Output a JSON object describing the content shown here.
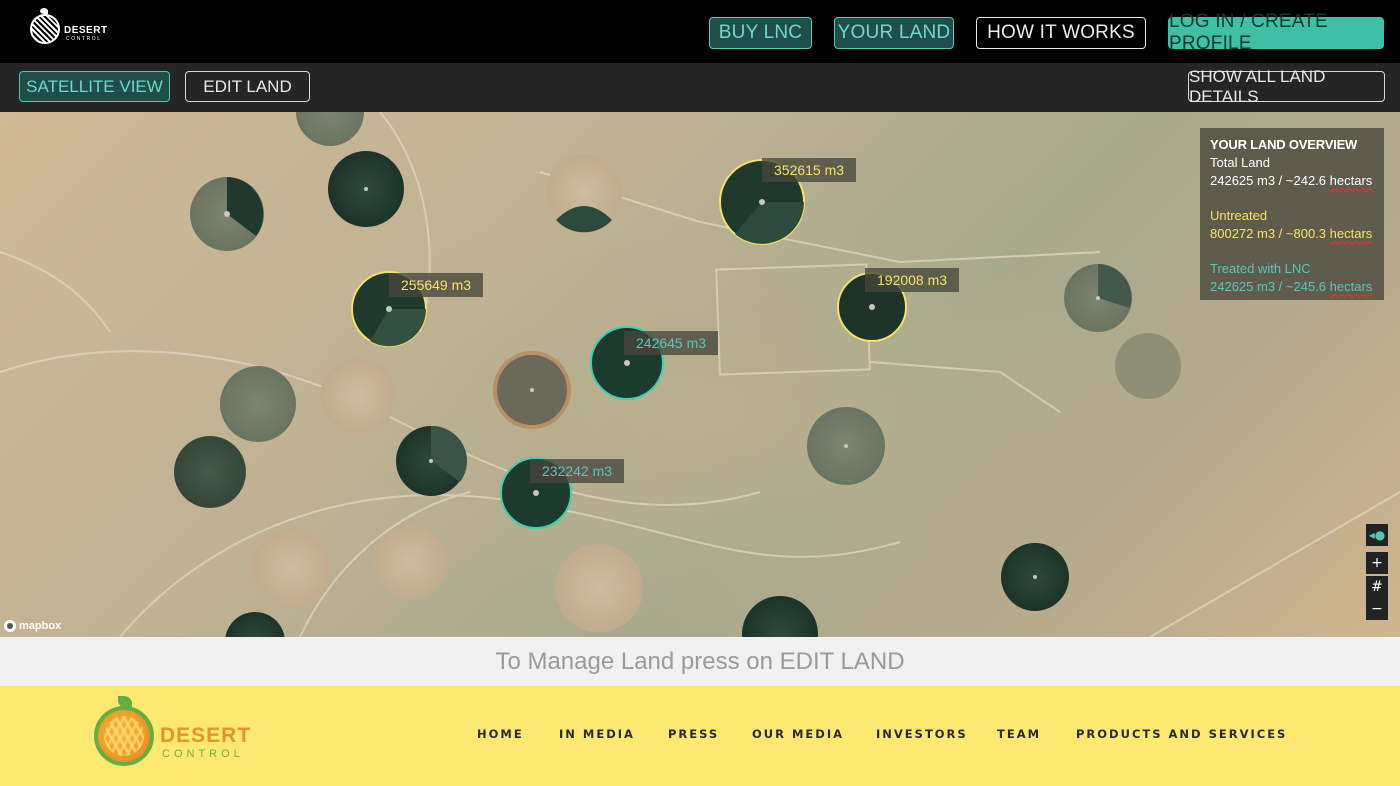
{
  "header": {
    "logo_brand": "DESERT",
    "logo_sub": "CONTROL",
    "buttons": {
      "buy": "BUY LNC",
      "your_land": "YOUR LAND",
      "how": "HOW IT WORKS",
      "login": "LOG IN / CREATE PROFILE"
    }
  },
  "toolbar": {
    "satellite": "SATELLITE VIEW",
    "edit": "EDIT LAND",
    "show_all": "SHOW ALL LAND DETAILS"
  },
  "map": {
    "labels": [
      {
        "text": "352615 m3",
        "status": "untreated"
      },
      {
        "text": "255649 m3",
        "status": "untreated"
      },
      {
        "text": "192008 m3",
        "status": "untreated"
      },
      {
        "text": "242645 m3",
        "status": "treated"
      },
      {
        "text": "232242 m3",
        "status": "treated"
      }
    ],
    "attribution": "mapbox",
    "controls": {
      "zoom_in": "+",
      "grid": "#",
      "zoom_out": "−"
    }
  },
  "overview": {
    "title": "YOUR LAND OVERVIEW",
    "total_label": "Total Land",
    "total_value": "242625 m3 / ~242.6",
    "untreated_label": "Untreated",
    "untreated_value": "800272 m3 / ~800.3",
    "treated_label": "Treated with LNC",
    "treated_value": "242625 m3 / ~245.6",
    "unit": "hectars"
  },
  "instruction": "To Manage Land press on EDIT LAND",
  "footer": {
    "logo_brand": "DESERT",
    "logo_sub": "CONTROL",
    "links": [
      "HOME",
      "IN MEDIA",
      "PRESS",
      "OUR MEDIA",
      "INVESTORS",
      "TEAM",
      "PRODUCTS AND SERVICES"
    ]
  },
  "colors": {
    "accent_teal": "#3fbfa6",
    "untreated_yellow": "#f4e36a",
    "footer_bg": "#fde872"
  }
}
